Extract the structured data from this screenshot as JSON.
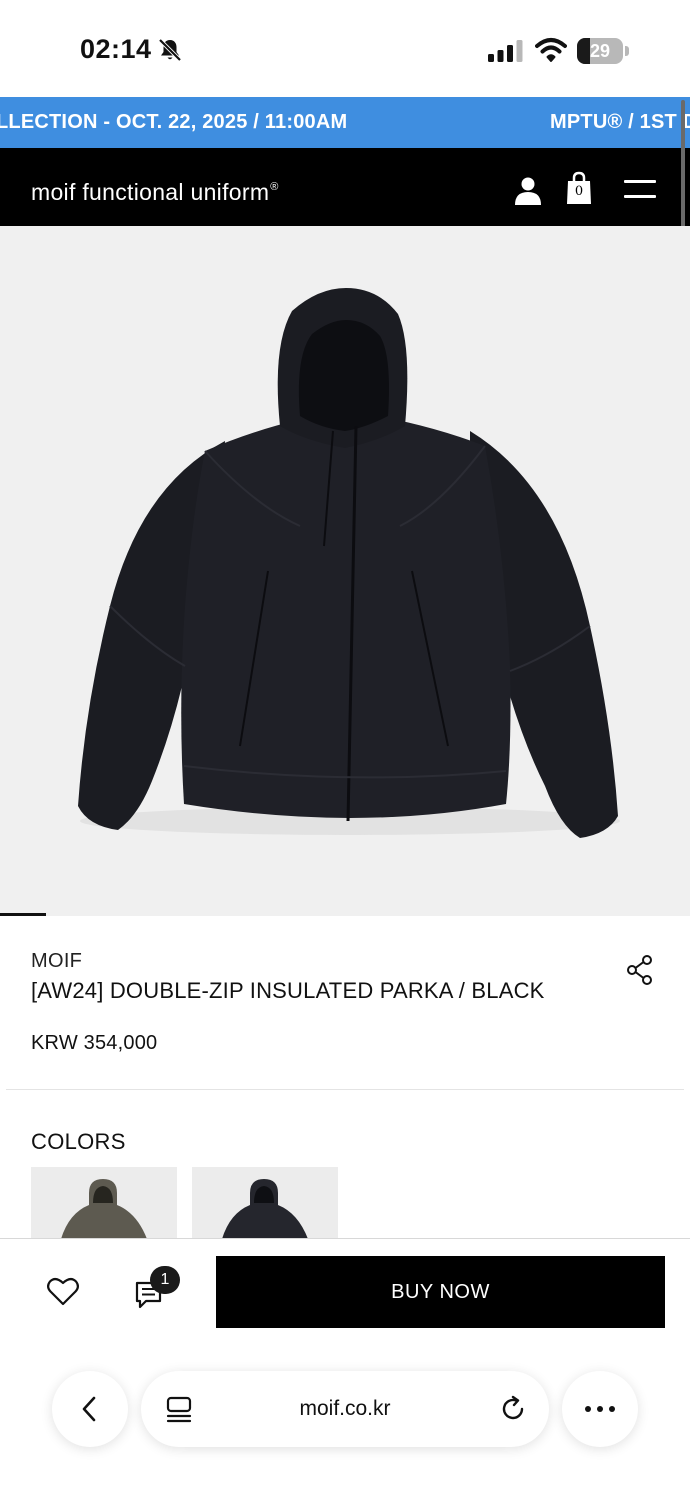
{
  "status_bar": {
    "time": "02:14",
    "battery_level": "29",
    "battery_fraction": 0.29
  },
  "announcement": {
    "text_left": "LLECTION - OCT. 22, 2025 / 11:00AM",
    "text_right": "MPTU® / 1ST D"
  },
  "header": {
    "logo": "moif functional uniform",
    "logo_mark": "®",
    "cart_count": "0"
  },
  "product": {
    "brand": "MOIF",
    "name": "[AW24] DOUBLE-ZIP INSULATED PARKA / BLACK",
    "price": "KRW 354,000",
    "image_icon": "black-hooded-parka-image",
    "colors_title": "COLORS",
    "color_swatches": [
      "khaki-parka-swatch",
      "black-parka-swatch"
    ]
  },
  "actions": {
    "review_count": "1",
    "buy_label": "BUY NOW"
  },
  "browser": {
    "url": "moif.co.kr"
  },
  "colors": {
    "announce_bg": "#3f8ee0",
    "header_bg": "#000000",
    "buy_bg": "#000000"
  }
}
